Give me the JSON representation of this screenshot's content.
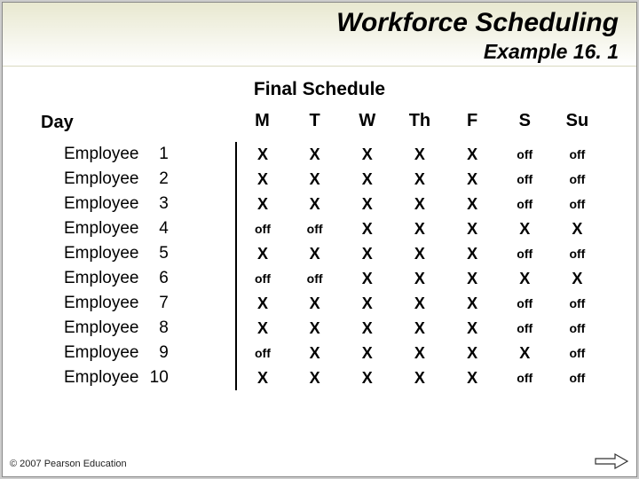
{
  "header": {
    "title": "Workforce Scheduling",
    "subtitle": "Example 16. 1"
  },
  "section_title": "Final Schedule",
  "day_label": "Day",
  "days": [
    "M",
    "T",
    "W",
    "Th",
    "F",
    "S",
    "Su"
  ],
  "x_mark": "X",
  "off_mark": "off",
  "rows": [
    {
      "label": "Employee",
      "num": "1",
      "cells": [
        "X",
        "X",
        "X",
        "X",
        "X",
        "off",
        "off"
      ]
    },
    {
      "label": "Employee",
      "num": "2",
      "cells": [
        "X",
        "X",
        "X",
        "X",
        "X",
        "off",
        "off"
      ]
    },
    {
      "label": "Employee",
      "num": "3",
      "cells": [
        "X",
        "X",
        "X",
        "X",
        "X",
        "off",
        "off"
      ]
    },
    {
      "label": "Employee",
      "num": "4",
      "cells": [
        "off",
        "off",
        "X",
        "X",
        "X",
        "X",
        "X"
      ]
    },
    {
      "label": "Employee",
      "num": "5",
      "cells": [
        "X",
        "X",
        "X",
        "X",
        "X",
        "off",
        "off"
      ]
    },
    {
      "label": "Employee",
      "num": "6",
      "cells": [
        "off",
        "off",
        "X",
        "X",
        "X",
        "X",
        "X"
      ]
    },
    {
      "label": "Employee",
      "num": "7",
      "cells": [
        "X",
        "X",
        "X",
        "X",
        "X",
        "off",
        "off"
      ]
    },
    {
      "label": "Employee",
      "num": "8",
      "cells": [
        "X",
        "X",
        "X",
        "X",
        "X",
        "off",
        "off"
      ]
    },
    {
      "label": "Employee",
      "num": "9",
      "cells": [
        "off",
        "X",
        "X",
        "X",
        "X",
        "X",
        "off"
      ]
    },
    {
      "label": "Employee",
      "num": "10",
      "cells": [
        "X",
        "X",
        "X",
        "X",
        "X",
        "off",
        "off"
      ]
    }
  ],
  "copyright": "© 2007 Pearson Education",
  "chart_data": {
    "type": "table",
    "title": "Final Schedule",
    "columns": [
      "M",
      "T",
      "W",
      "Th",
      "F",
      "S",
      "Su"
    ],
    "rows": [
      {
        "label": "Employee 1",
        "values": [
          "X",
          "X",
          "X",
          "X",
          "X",
          "off",
          "off"
        ]
      },
      {
        "label": "Employee 2",
        "values": [
          "X",
          "X",
          "X",
          "X",
          "X",
          "off",
          "off"
        ]
      },
      {
        "label": "Employee 3",
        "values": [
          "X",
          "X",
          "X",
          "X",
          "X",
          "off",
          "off"
        ]
      },
      {
        "label": "Employee 4",
        "values": [
          "off",
          "off",
          "X",
          "X",
          "X",
          "X",
          "X"
        ]
      },
      {
        "label": "Employee 5",
        "values": [
          "X",
          "X",
          "X",
          "X",
          "X",
          "off",
          "off"
        ]
      },
      {
        "label": "Employee 6",
        "values": [
          "off",
          "off",
          "X",
          "X",
          "X",
          "X",
          "X"
        ]
      },
      {
        "label": "Employee 7",
        "values": [
          "X",
          "X",
          "X",
          "X",
          "X",
          "off",
          "off"
        ]
      },
      {
        "label": "Employee 8",
        "values": [
          "X",
          "X",
          "X",
          "X",
          "X",
          "off",
          "off"
        ]
      },
      {
        "label": "Employee 9",
        "values": [
          "off",
          "X",
          "X",
          "X",
          "X",
          "X",
          "off"
        ]
      },
      {
        "label": "Employee 10",
        "values": [
          "X",
          "X",
          "X",
          "X",
          "X",
          "off",
          "off"
        ]
      }
    ]
  }
}
